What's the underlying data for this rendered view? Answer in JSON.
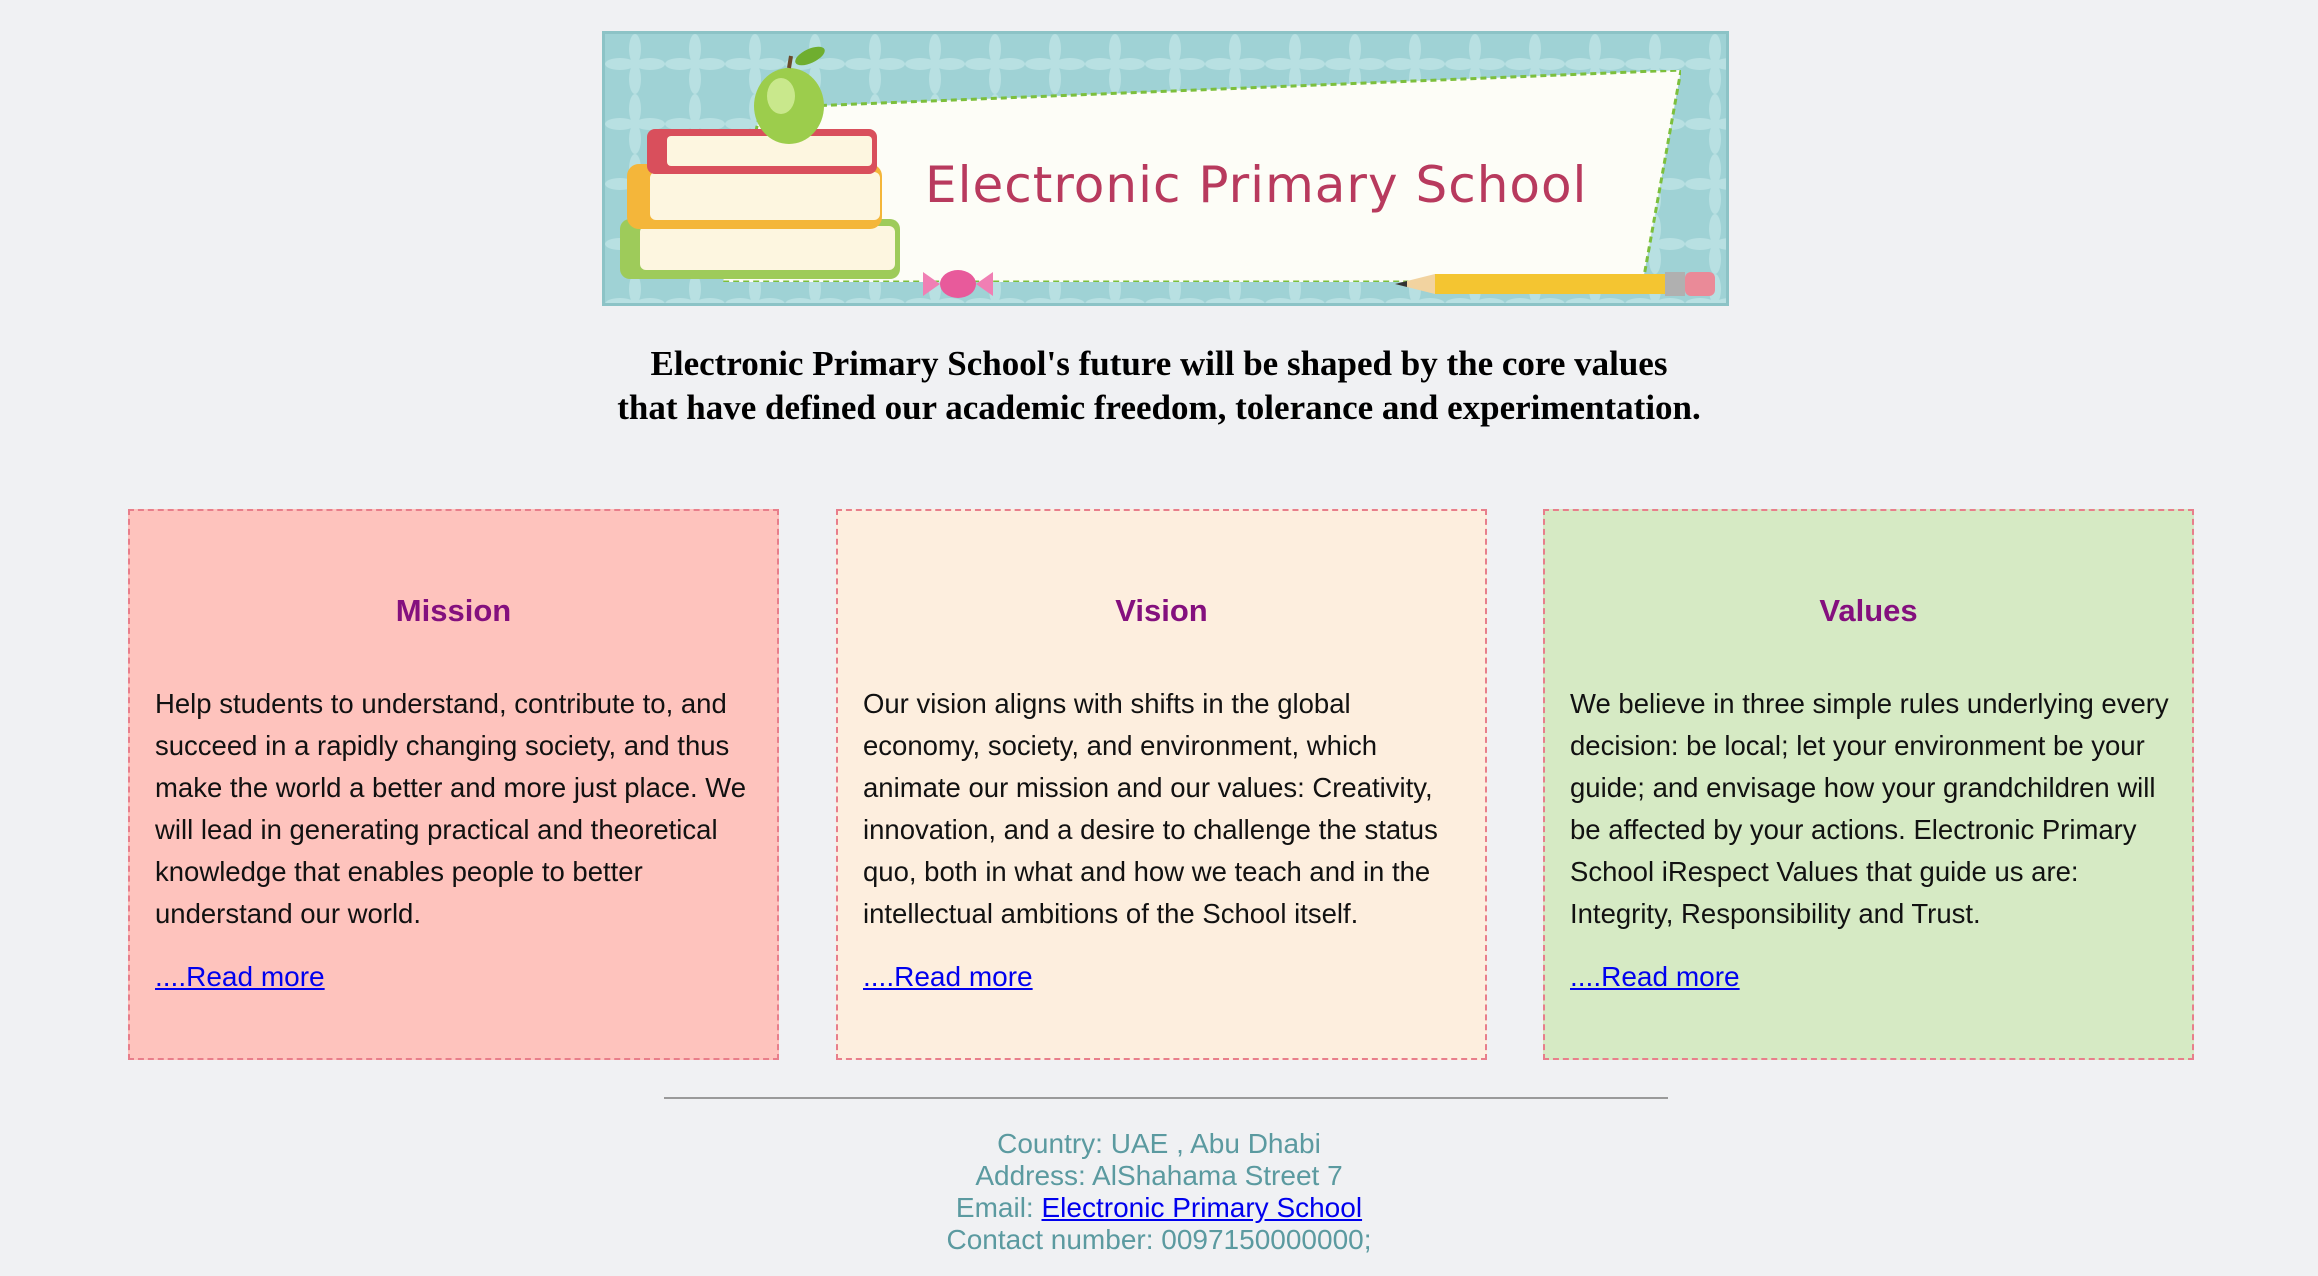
{
  "banner": {
    "title": "Electronic Primary School",
    "icons": [
      "books-icon",
      "apple-icon",
      "candy-icon",
      "pencil-icon"
    ]
  },
  "tagline": {
    "line1": "Electronic Primary School's future will be shaped by the core values",
    "line2": "that have defined our academic freedom, tolerance and experimentation."
  },
  "cards": [
    {
      "title": "Mission",
      "body": "Help students to understand, contribute to, and succeed in a rapidly changing society, and thus make the world a better and more just place. We will lead in generating practical and theoretical knowledge that enables people to better understand our world.",
      "link": "....Read more",
      "bg": "#fec3bd"
    },
    {
      "title": "Vision",
      "body": "Our vision aligns with shifts in the global economy, society, and environment, which animate our mission and our values: Creativity, innovation, and a desire to challenge the status quo, both in what and how we teach and in the intellectual ambitions of the School itself.",
      "link": "....Read more",
      "bg": "#fdeede"
    },
    {
      "title": "Values",
      "body": "We believe in three simple rules underlying every decision: be local; let your environment be your guide; and envisage how your grandchildren will be affected by your actions. Electronic Primary School iRespect Values that guide us are: Integrity, Responsibility and Trust.",
      "link": "....Read more",
      "bg": "#d6eac4"
    }
  ],
  "footer": {
    "country": "Country: UAE , Abu Dhabi",
    "address": "Address: AlShahama Street 7",
    "email_label": "Email:",
    "email_link": "Electronic Primary School",
    "contact": "Contact number: 0097150000000;"
  },
  "colors": {
    "page_bg": "#f0f1f3",
    "card_title": "#84107e",
    "footer_text": "#5b9aa0",
    "link": "#0000ee"
  }
}
